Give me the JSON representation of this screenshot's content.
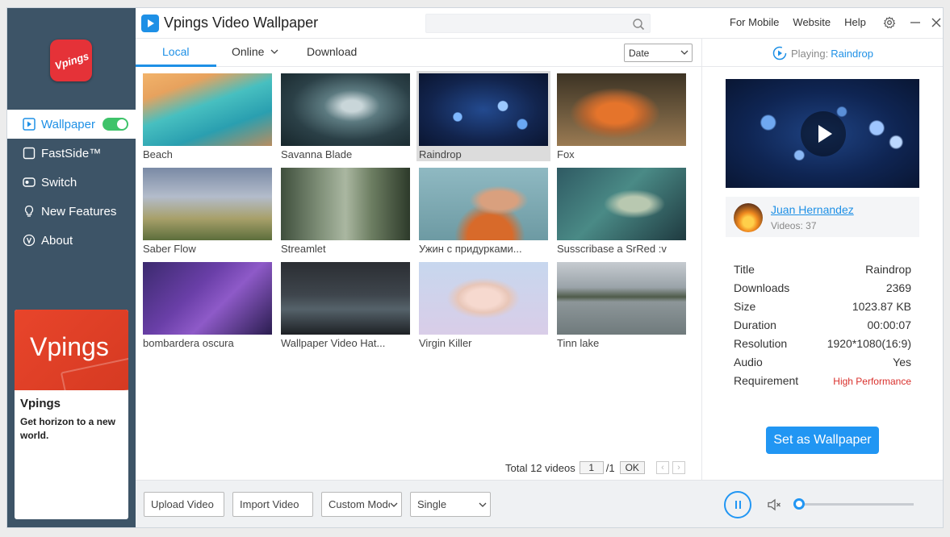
{
  "app": {
    "title": "Vpings Video Wallpaper"
  },
  "sidebar": {
    "logo_text": "Vpings",
    "items": [
      {
        "label": "Wallpaper",
        "icon": "play-square-icon",
        "active": true,
        "toggle_on": true
      },
      {
        "label": "FastSide™",
        "icon": "square-icon"
      },
      {
        "label": "Switch",
        "icon": "switch-icon"
      },
      {
        "label": "New Features",
        "icon": "bulb-icon"
      },
      {
        "label": "About",
        "icon": "info-v-icon"
      }
    ],
    "ad": {
      "banner_text": "Vpings",
      "title": "Vpings",
      "description": "Get horizon to a new world."
    }
  },
  "topbar": {
    "search_placeholder": "",
    "links": [
      "For Mobile",
      "Website",
      "Help"
    ]
  },
  "tabs": {
    "items": [
      "Local",
      "Online",
      "Download"
    ],
    "active": "Local",
    "sort_value": "Date"
  },
  "videos": [
    {
      "title": "Beach"
    },
    {
      "title": "Savanna Blade"
    },
    {
      "title": "Raindrop",
      "selected": true
    },
    {
      "title": "Fox"
    },
    {
      "title": "Saber Flow"
    },
    {
      "title": "Streamlet"
    },
    {
      "title": "Ужин с придурками..."
    },
    {
      "title": "Susscribase a SrRed :v"
    },
    {
      "title": "bombardera oscura"
    },
    {
      "title": "Wallpaper Video Hat..."
    },
    {
      "title": "Virgin Killer"
    },
    {
      "title": "Tinn lake"
    }
  ],
  "pager": {
    "total_label": "Total 12 videos",
    "page": "1",
    "of": "/1",
    "ok": "OK"
  },
  "details": {
    "playing_label": "Playing:",
    "playing_name": "Raindrop",
    "author": {
      "name": "Juan Hernandez",
      "videos": "Videos: 37"
    },
    "rows": [
      {
        "key": "Title",
        "value": "Raindrop"
      },
      {
        "key": "Downloads",
        "value": "2369"
      },
      {
        "key": "Size",
        "value": "1023.87 KB"
      },
      {
        "key": "Duration",
        "value": "00:00:07"
      },
      {
        "key": "Resolution",
        "value": "1920*1080(16:9)"
      },
      {
        "key": "Audio",
        "value": "Yes"
      },
      {
        "key": "Requirement",
        "value": "High Performance"
      }
    ],
    "set_button": "Set as Wallpaper"
  },
  "bottom": {
    "upload": "Upload Video",
    "import": "Import Video",
    "mode": "Custom Mode",
    "display": "Single",
    "volume": 0.0
  },
  "colors": {
    "accent": "#1e90e6",
    "sidebar": "#3d5467",
    "toggle": "#3ec36a",
    "warning": "#d9302c"
  }
}
